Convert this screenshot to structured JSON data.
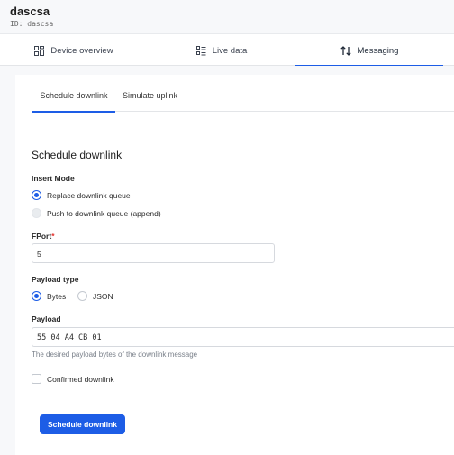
{
  "device": {
    "name": "dascsa",
    "id_line": "ID: dascsa"
  },
  "tabs": [
    {
      "label": "Device overview",
      "icon": "device-overview-icon"
    },
    {
      "label": "Live data",
      "icon": "live-data-icon"
    },
    {
      "label": "Messaging",
      "icon": "messaging-icon",
      "active": true
    }
  ],
  "subtabs": [
    {
      "label": "Schedule downlink",
      "active": true
    },
    {
      "label": "Simulate uplink"
    }
  ],
  "form": {
    "title": "Schedule downlink",
    "insert_mode": {
      "label": "Insert Mode",
      "options": [
        {
          "label": "Replace downlink queue",
          "checked": true
        },
        {
          "label": "Push to downlink queue (append)",
          "checked": false
        }
      ]
    },
    "fport": {
      "label": "FPort",
      "required_mark": "*",
      "value": "5"
    },
    "payload_type": {
      "label": "Payload type",
      "options": [
        {
          "label": "Bytes",
          "checked": true
        },
        {
          "label": "JSON",
          "checked": false
        }
      ]
    },
    "payload": {
      "label": "Payload",
      "value": "55 04 A4 CB 01",
      "help": "The desired payload bytes of the downlink message"
    },
    "confirmed": {
      "label": "Confirmed downlink",
      "checked": false
    },
    "submit_label": "Schedule downlink"
  },
  "colors": {
    "accent": "#1d5de6",
    "required": "#e3342f"
  }
}
